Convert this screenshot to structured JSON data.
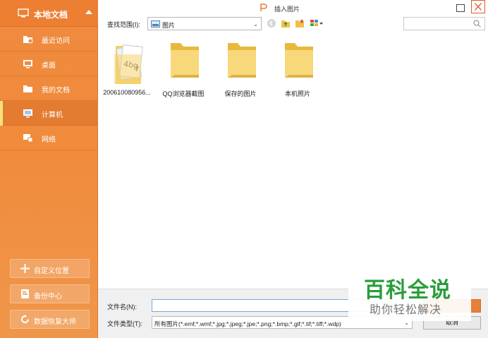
{
  "sidebar": {
    "title": "本地文档",
    "items": [
      {
        "label": "最近访问",
        "icon": "recent-folder-icon"
      },
      {
        "label": "桌面",
        "icon": "desktop-icon"
      },
      {
        "label": "我的文档",
        "icon": "folder-icon"
      },
      {
        "label": "计算机",
        "icon": "computer-icon",
        "active": true
      },
      {
        "label": "网络",
        "icon": "network-icon"
      }
    ],
    "buttons": [
      {
        "label": "自定义位置",
        "icon": "plus-icon"
      },
      {
        "label": "备份中心",
        "icon": "backup-icon"
      },
      {
        "label": "数据恢复大师",
        "icon": "recovery-icon"
      }
    ]
  },
  "dialog": {
    "title": "插入图片"
  },
  "lookin": {
    "label": "查找范围(I):",
    "value": "图片"
  },
  "search": {
    "placeholder": ""
  },
  "files": [
    {
      "name": "200610080956...",
      "type": "image-file"
    },
    {
      "name": "QQ浏览器截图",
      "type": "folder"
    },
    {
      "name": "保存的图片",
      "type": "folder"
    },
    {
      "name": "本机照片",
      "type": "folder"
    }
  ],
  "bottom": {
    "filename_label": "文件名(N):",
    "filename_value": "",
    "filetype_label": "文件类型(T):",
    "filetype_value": "所有图片(*.emf;*.wmf;*.jpg;*.jpeg;*.jpe;*.png;*.bmp;*.gif;*.tif;*.tiff;*.wdp)",
    "cancel_label": "取消"
  },
  "watermark": {
    "main": "百科全说",
    "sub": "助你轻松解决"
  },
  "colors": {
    "sidebar_orange": "#f08b3c",
    "active_marker": "#f6e27a",
    "close_red": "#e05a2b",
    "watermark_green": "#2a9d3a",
    "folder_yellow": "#f5d36e"
  }
}
